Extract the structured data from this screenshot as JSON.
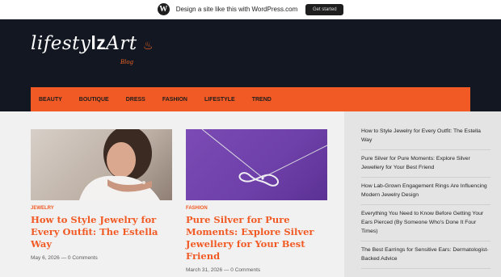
{
  "wpbar": {
    "text": "Design a site like this with WordPress.com",
    "button": "Get started"
  },
  "logo": {
    "text_a": "lifesty",
    "text_b": "lz",
    "text_c": "Art",
    "sub": "Blog"
  },
  "nav": [
    "BEAUTY",
    "BOUTIQUE",
    "DRESS",
    "FASHION",
    "LIFESTYLE",
    "TREND"
  ],
  "posts": [
    {
      "category": "JEWELRY",
      "title": "How to Style Jewelry for Every Outfit: The Estella Way",
      "date": "May 6, 2026",
      "comments": "0 Comments"
    },
    {
      "category": "FASHION",
      "title": "Pure Silver for Pure Moments: Explore Silver Jewellery for Your Best Friend",
      "date": "March 31, 2026",
      "comments": "0 Comments"
    }
  ],
  "sidebar": [
    "How to Style Jewelry for Every Outfit: The Estella Way",
    "Pure Silver for Pure Moments: Explore Silver Jewellery for Your Best Friend",
    "How Lab-Grown Engagement Rings Are Influencing Modern Jewelry Design",
    "Everything You Need to Know Before Getting Your Ears Pierced (By Someone Who's Done It Four Times)",
    "The Best Earrings for Sensitive Ears: Dermatologist-Backed Advice"
  ],
  "colors": {
    "accent": "#f15a24",
    "header_bg": "#121722"
  }
}
